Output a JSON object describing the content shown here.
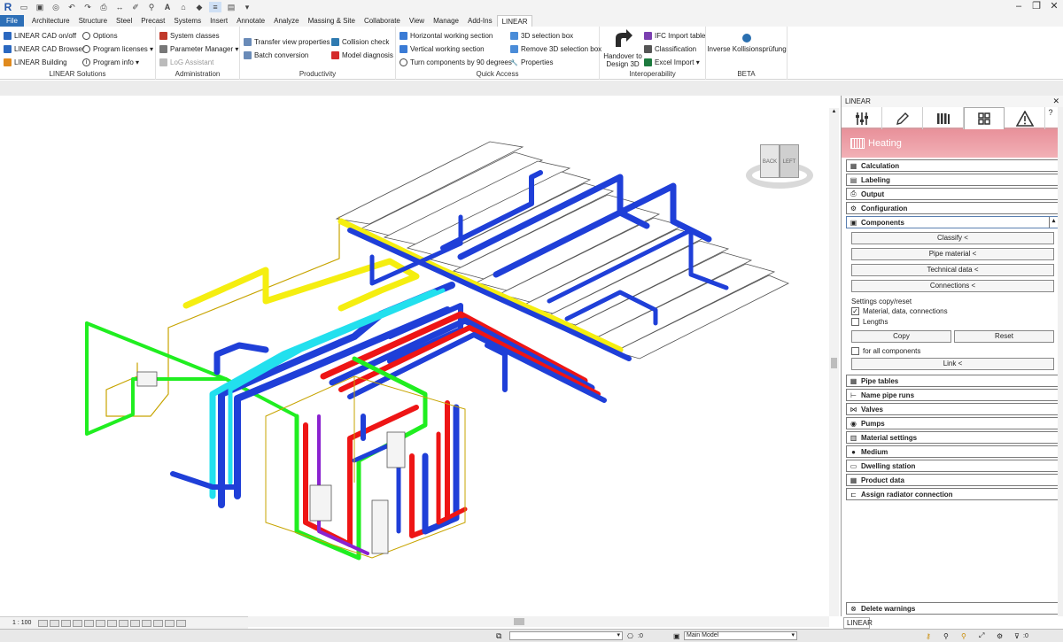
{
  "app": {
    "logo": "R"
  },
  "tabs": [
    "File",
    "Architecture",
    "Structure",
    "Steel",
    "Precast",
    "Systems",
    "Insert",
    "Annotate",
    "Analyze",
    "Massing & Site",
    "Collaborate",
    "View",
    "Manage",
    "Add-Ins",
    "LINEAR"
  ],
  "active_tab": "LINEAR",
  "ribbon": {
    "linear_solutions": {
      "title": "LINEAR Solutions",
      "items": [
        "LINEAR CAD on/off",
        "LINEAR CAD Browser",
        "LINEAR Building"
      ],
      "items2": [
        "Options",
        "Program licenses",
        "Program info"
      ]
    },
    "administration": {
      "title": "Administration",
      "items": [
        "System classes",
        "Parameter Manager",
        "LoG Assistant"
      ]
    },
    "productivity": {
      "title": "Productivity",
      "items": [
        "Transfer view  properties",
        "Batch conversion"
      ],
      "items2": [
        "Collision check",
        "Model diagnosis"
      ]
    },
    "quick_access": {
      "title": "Quick Access",
      "items": [
        "Horizontal working section",
        "Vertical working section",
        "Turn components by 90 degrees"
      ],
      "items2": [
        "3D selection box",
        "Remove 3D selection box",
        "Properties"
      ]
    },
    "interoperability": {
      "title": "Interoperability",
      "big": "Handover to Design 3D",
      "items": [
        "IFC Import table",
        "Classification",
        "Excel Import"
      ]
    },
    "beta": {
      "title": "BETA",
      "items": [
        "Inverse Kollisionsprüfung"
      ]
    }
  },
  "viewcube": {
    "back": "BACK",
    "left": "LEFT"
  },
  "viewbar": {
    "scale": "1 : 100"
  },
  "status": {
    "workset_value": "",
    "count1": ":0",
    "model": "Main Model",
    "count2": ":0"
  },
  "panel": {
    "title": "LINEAR",
    "header": "Heating",
    "sections_top": [
      "Calculation",
      "Labeling",
      "Output",
      "Configuration"
    ],
    "components": {
      "label": "Components",
      "buttons": [
        "Classify  <",
        "Pipe material  <",
        "Technical data  <",
        "Connections  <"
      ],
      "settings_label": "Settings",
      "settings_suffix": " copy/reset",
      "chk_material": "Material, data, connections",
      "chk_lengths": "Lengths",
      "copy": "Copy",
      "reset": "Reset",
      "chk_all": "for all components",
      "link": "Link  <"
    },
    "sections_bottom": [
      "Pipe tables",
      "Name pipe runs",
      "Valves",
      "Pumps",
      "Material settings",
      "Medium",
      "Dwelling station",
      "Product data",
      "Assign radiator connection"
    ],
    "footer": "Delete warnings"
  },
  "colors": {
    "blue": "#1f3fd8",
    "cyan": "#22e0ee",
    "yellow": "#f5ee10",
    "red": "#ee1515",
    "green": "#20ee20",
    "purple": "#8a22d0",
    "ribbon_active": "#2d6fb7"
  }
}
